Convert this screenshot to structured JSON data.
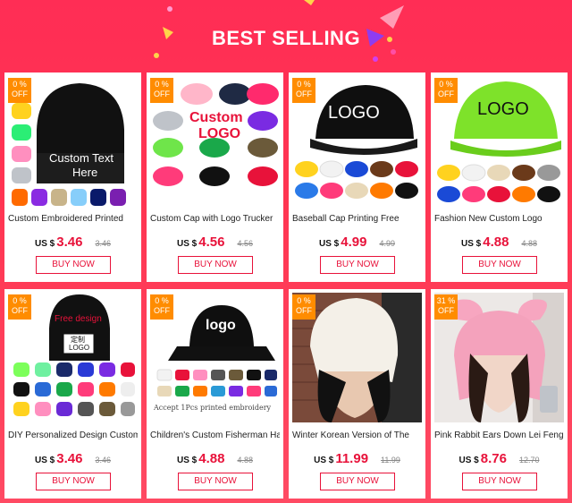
{
  "banner": {
    "title": "BEST SELLING"
  },
  "colors": {
    "background": "#ff3552",
    "accent": "#e8123a",
    "badge": "#ff8c00"
  },
  "products": [
    {
      "title": "Custom Embroidered Printed",
      "currency": "US $",
      "price": "3.46",
      "old_price": "3.46",
      "button": "BUY NOW",
      "badge_pct": "0 %",
      "badge_off": "OFF",
      "image_text_1": "Custom Text",
      "image_text_2": "Here"
    },
    {
      "title": "Custom Cap with Logo Trucker",
      "currency": "US $",
      "price": "4.56",
      "old_price": "4.56",
      "button": "BUY NOW",
      "badge_pct": "0 %",
      "badge_off": "OFF",
      "image_text_1": "Custom",
      "image_text_2": "LOGO"
    },
    {
      "title": "Baseball Cap Printing Free",
      "currency": "US $",
      "price": "4.99",
      "old_price": "4.99",
      "button": "BUY NOW",
      "badge_pct": "0 %",
      "badge_off": "OFF",
      "image_text_1": "LOGO"
    },
    {
      "title": "Fashion New Custom Logo",
      "currency": "US $",
      "price": "4.88",
      "old_price": "4.88",
      "button": "BUY NOW",
      "badge_pct": "0 %",
      "badge_off": "OFF",
      "image_text_1": "LOGO"
    },
    {
      "title": "DIY Personalized Design Custom",
      "currency": "US $",
      "price": "3.46",
      "old_price": "3.46",
      "button": "BUY NOW",
      "badge_pct": "0 %",
      "badge_off": "OFF",
      "image_text_1": "Free design",
      "image_text_2": "定制",
      "image_text_3": "LOGO"
    },
    {
      "title": "Children's Custom Fisherman Hat",
      "currency": "US $",
      "price": "4.88",
      "old_price": "4.88",
      "button": "BUY NOW",
      "badge_pct": "0 %",
      "badge_off": "OFF",
      "image_text_1": "logo",
      "image_text_2": "Accept 1Pcs printed embroidery"
    },
    {
      "title": "Winter Korean Version of The",
      "currency": "US $",
      "price": "11.99",
      "old_price": "11.99",
      "button": "BUY NOW",
      "badge_pct": "0 %",
      "badge_off": "OFF"
    },
    {
      "title": "Pink Rabbit Ears Down Lei Feng",
      "currency": "US $",
      "price": "8.76",
      "old_price": "12.70",
      "button": "BUY NOW",
      "badge_pct": "31 %",
      "badge_off": "OFF"
    }
  ]
}
